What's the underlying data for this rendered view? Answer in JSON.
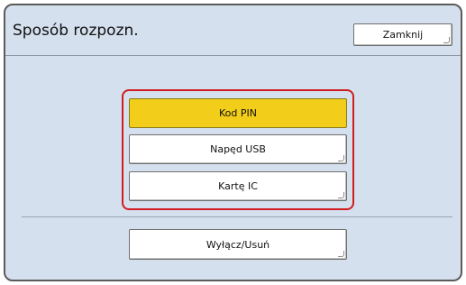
{
  "header": {
    "title": "Sposób rozpozn."
  },
  "close_button": {
    "label": "Zamknij"
  },
  "options": [
    {
      "label": "Kod PIN",
      "selected": true
    },
    {
      "label": "Napęd USB",
      "selected": false
    },
    {
      "label": "Kartę IC",
      "selected": false
    }
  ],
  "disable_button": {
    "label": "Wyłącz/Usuń"
  },
  "colors": {
    "panel_background": "#d5e0ee",
    "selected_button": "#f2cd1a",
    "group_outline": "#d01c20"
  }
}
